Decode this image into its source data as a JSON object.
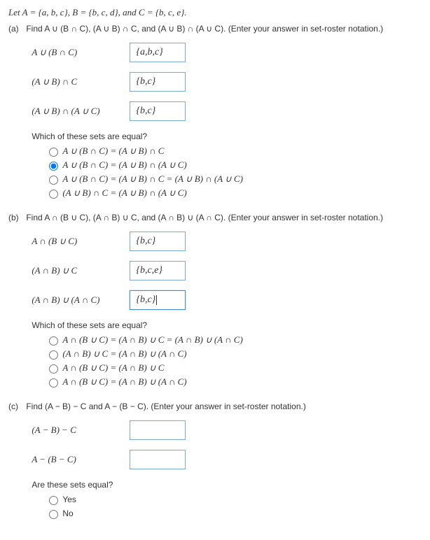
{
  "intro": "Let A = {a, b, c}, B = {b, c, d}, and C = {b, c, e}.",
  "parts": {
    "a": {
      "label": "(a)",
      "prompt": "Find A ∪ (B ∩ C), (A ∪ B) ∩ C, and (A ∪ B) ∩ (A ∪ C). (Enter your answer in set-roster notation.)",
      "rows": [
        {
          "label": "A ∪ (B ∩ C)",
          "value": "{a,b,c}"
        },
        {
          "label": "(A ∪ B) ∩ C",
          "value": "{b,c}"
        },
        {
          "label": "(A ∪ B) ∩ (A ∪ C)",
          "value": "{b,c}"
        }
      ],
      "which": "Which of these sets are equal?",
      "options": [
        "A ∪ (B ∩ C) = (A ∪ B) ∩ C",
        "A ∪ (B ∩ C) = (A ∪ B) ∩ (A ∪ C)",
        "A ∪ (B ∩ C) = (A ∪ B) ∩ C = (A ∪ B) ∩ (A ∪ C)",
        "(A ∪ B) ∩ C = (A ∪ B) ∩ (A ∪ C)"
      ],
      "selected": 1
    },
    "b": {
      "label": "(b)",
      "prompt": "Find A ∩ (B ∪ C), (A ∩ B) ∪ C, and (A ∩ B) ∪ (A ∩ C). (Enter your answer in set-roster notation.)",
      "rows": [
        {
          "label": "A ∩ (B ∪ C)",
          "value": "{b,c}"
        },
        {
          "label": "(A ∩ B) ∪ C",
          "value": "{b,c,e}"
        },
        {
          "label": "(A ∩ B) ∪ (A ∩ C)",
          "value": "{b,c}",
          "focused": true
        }
      ],
      "which": "Which of these sets are equal?",
      "options": [
        "A ∩ (B ∪ C) = (A ∩ B) ∪ C = (A ∩ B) ∪ (A ∩ C)",
        "(A ∩ B) ∪ C = (A ∩ B) ∪ (A ∩ C)",
        "A ∩ (B ∪ C) = (A ∩ B) ∪ C",
        "A ∩ (B ∪ C) = (A ∩ B) ∪ (A ∩ C)"
      ],
      "selected": -1
    },
    "c": {
      "label": "(c)",
      "prompt": "Find (A − B) − C and A − (B − C). (Enter your answer in set-roster notation.)",
      "rows": [
        {
          "label": "(A − B) − C",
          "value": ""
        },
        {
          "label": "A − (B − C)",
          "value": ""
        }
      ],
      "which": "Are these sets equal?",
      "options": [
        "Yes",
        "No"
      ],
      "selected": -1,
      "plain": true
    }
  }
}
